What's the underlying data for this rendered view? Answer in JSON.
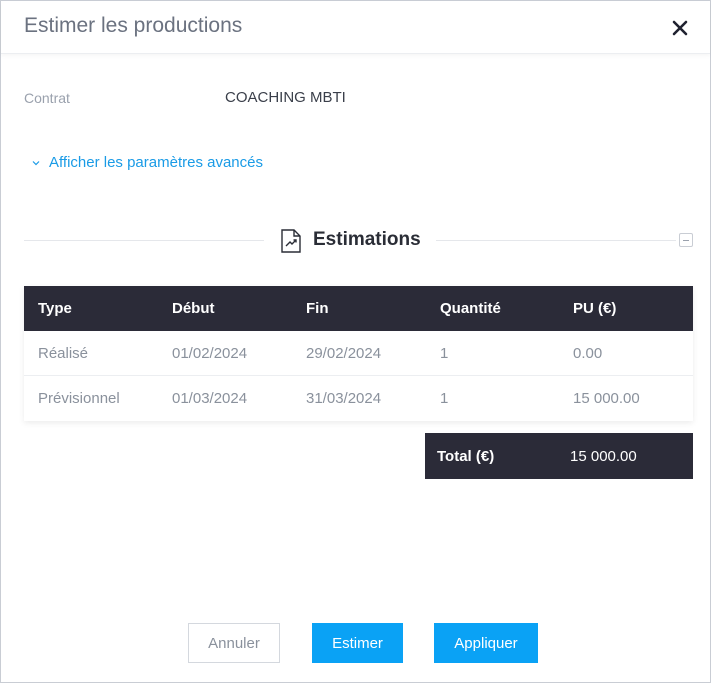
{
  "modal": {
    "title": "Estimer les productions",
    "close_icon": "close-icon"
  },
  "contract": {
    "label": "Contrat",
    "value": "COACHING MBTI"
  },
  "advanced": {
    "label": "Afficher les paramètres avancés",
    "icon": "chevron-down-icon"
  },
  "section": {
    "title": "Estimations",
    "icon": "chart-document-icon"
  },
  "table": {
    "headers": [
      "Type",
      "Début",
      "Fin",
      "Quantité",
      "PU (€)"
    ],
    "rows": [
      [
        "Réalisé",
        "01/02/2024",
        "29/02/2024",
        "1",
        "0.00"
      ],
      [
        "Prévisionnel",
        "01/03/2024",
        "31/03/2024",
        "1",
        "15 000.00"
      ]
    ]
  },
  "total": {
    "label": "Total (€)",
    "value": "15 000.00"
  },
  "footer": {
    "cancel": "Annuler",
    "estimate": "Estimer",
    "apply": "Appliquer"
  },
  "colors": {
    "accent": "#0aa2f5",
    "link": "#1a9be6",
    "header_dark": "#2b2b38"
  }
}
